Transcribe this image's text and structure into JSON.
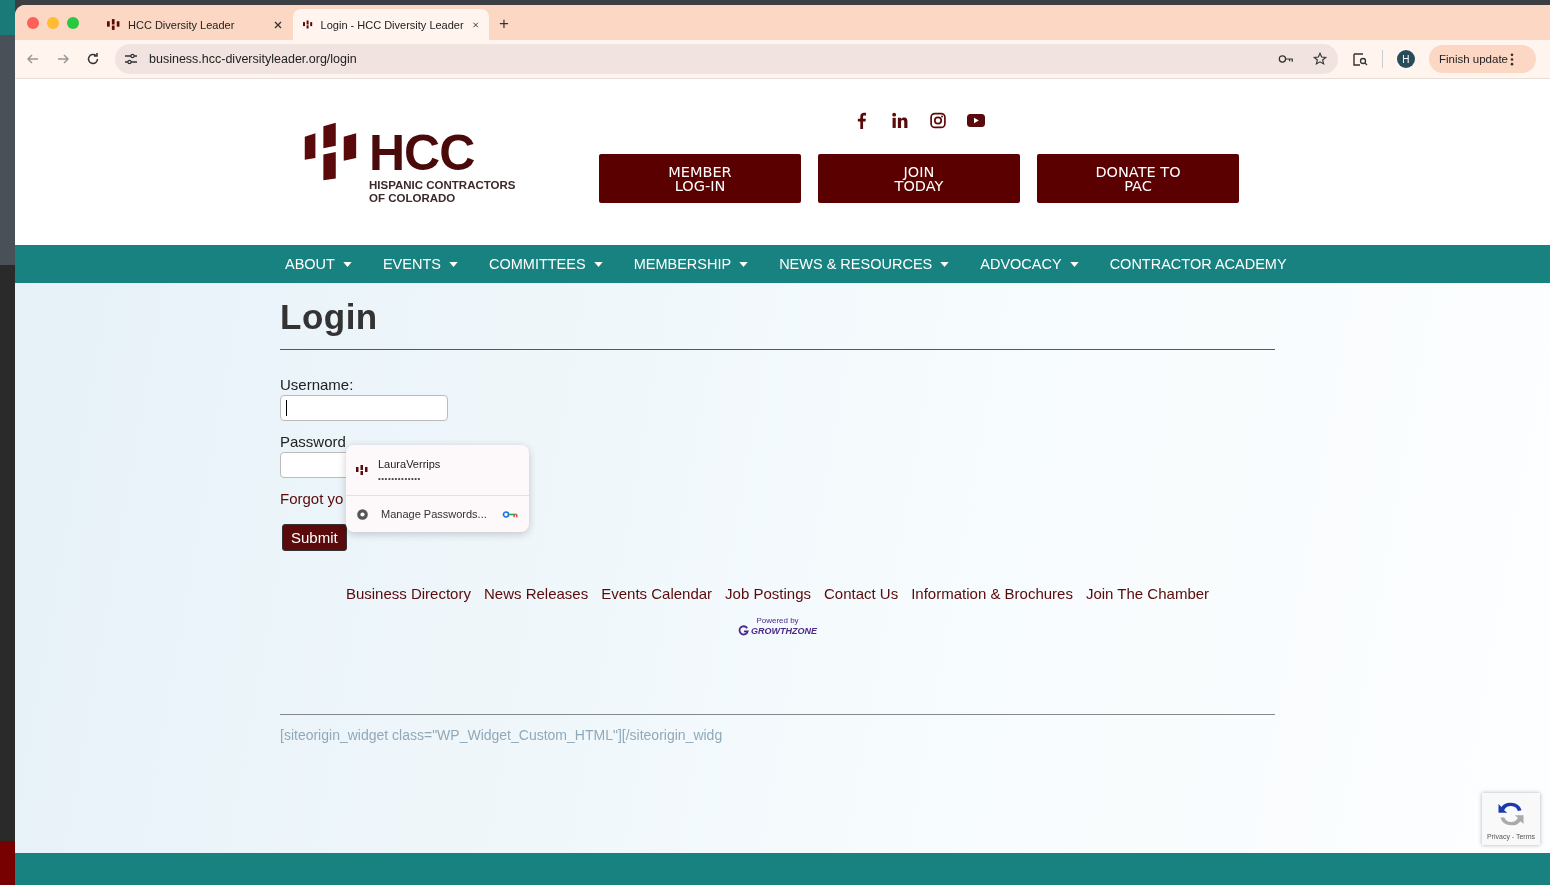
{
  "browser": {
    "tabs": [
      {
        "label": "HCC Diversity Leader",
        "selected": false
      },
      {
        "label": "Login - HCC Diversity Leader",
        "selected": true
      }
    ],
    "new_tab": "+",
    "url": "business.hcc-diversityleader.org/login",
    "profile": "H",
    "update_button": "Finish update"
  },
  "header": {
    "logo": {
      "name": "HCC",
      "subtitle": "HISPANIC CONTRACTORS OF COLORADO"
    },
    "buttons": [
      {
        "lines": [
          "MEMBER",
          "LOG-IN"
        ]
      },
      {
        "lines": [
          "JOIN",
          "TODAY"
        ]
      },
      {
        "lines": [
          "DONATE TO",
          "PAC"
        ]
      }
    ]
  },
  "nav": [
    {
      "label": "ABOUT",
      "dropdown": true
    },
    {
      "label": "EVENTS",
      "dropdown": true
    },
    {
      "label": "COMMITTEES",
      "dropdown": true
    },
    {
      "label": "MEMBERSHIP",
      "dropdown": true
    },
    {
      "label": "NEWS & RESOURCES",
      "dropdown": true
    },
    {
      "label": "ADVOCACY",
      "dropdown": true
    },
    {
      "label": "CONTRACTOR ACADEMY",
      "dropdown": false
    }
  ],
  "page": {
    "title": "Login",
    "username_label": "Username:",
    "password_label": "Password",
    "forgot_text": "Forgot yo",
    "submit": "Submit"
  },
  "autofill": {
    "username": "LauraVerrips",
    "password_mask": "•••••••••••••",
    "manage": "Manage Passwords..."
  },
  "footer_links": [
    "Business Directory",
    "News Releases",
    "Events Calendar",
    "Job Postings",
    "Contact Us",
    "Information & Brochures",
    "Join The Chamber"
  ],
  "powered_by": {
    "label": "Powered by",
    "brand": "GROWTHZONE"
  },
  "shortcode": "[siteorigin_widget class=\"WP_Widget_Custom_HTML\"][/siteorigin_widg",
  "recaptcha": {
    "links": "Privacy - Terms"
  }
}
